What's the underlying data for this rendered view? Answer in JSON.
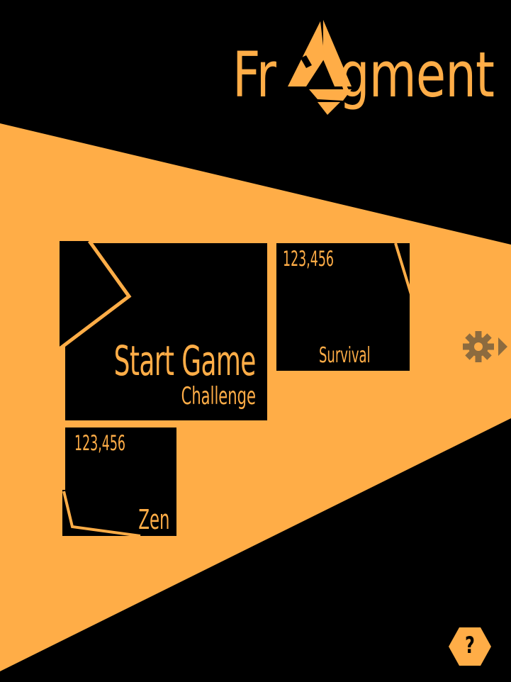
{
  "title": {
    "prefix": "Fr",
    "suffix": "gment"
  },
  "main_tile": {
    "label": "Start Game",
    "mode": "Challenge"
  },
  "survival_tile": {
    "score": "123,456",
    "label": "Survival"
  },
  "zen_tile": {
    "score": "123,456",
    "label": "Zen"
  },
  "settings": {
    "icon": "gear-icon"
  },
  "help": {
    "label": "?"
  },
  "colors": {
    "accent": "#FFAD47",
    "background": "#000000",
    "icon_gray": "#8C6B3F"
  }
}
